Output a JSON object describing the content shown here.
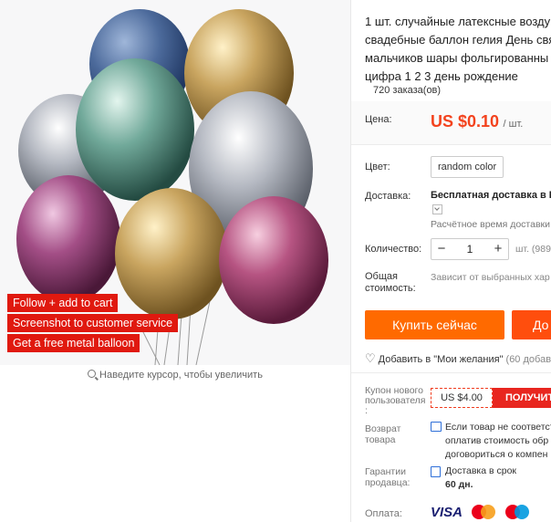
{
  "left": {
    "promos": [
      "Follow + add to cart",
      "Screenshot  to customer service",
      "Get a free metal balloon"
    ],
    "zoom_hint": "Наведите курсор, чтобы увеличить"
  },
  "product": {
    "title_lines": [
      "1 шт. случайные латексные возду",
      "свадебные баллон гелия День свя",
      "мальчиков шары фольгированны",
      "цифра 1 2 3 день рождение"
    ],
    "orders": "720 заказа(ов)"
  },
  "price": {
    "label": "Цена:",
    "amount": "US $0.10",
    "unit": "/ шт."
  },
  "color": {
    "label": "Цвет:",
    "value": "random color"
  },
  "shipping": {
    "label": "Доставка:",
    "title": "Бесплатная доставка в Ru",
    "estimate": "Расчётное время доставки"
  },
  "quantity": {
    "label": "Количество:",
    "minus": "−",
    "value": "1",
    "plus": "+",
    "note": "шт. (989"
  },
  "total": {
    "label_lines": [
      "Общая",
      "стоимость:"
    ],
    "note": "Зависит от выбранных хар"
  },
  "buttons": {
    "buy": "Купить сейчас",
    "cart": "До"
  },
  "wishlist": {
    "text": "Добавить в \"Мои желания\"",
    "count": "(60 добав"
  },
  "coupon": {
    "label_lines": [
      "Купон нового",
      "пользователя",
      ":"
    ],
    "value": "US $4.00",
    "button": "ПОЛУЧИТ"
  },
  "returns": {
    "label_lines": [
      "Возврат",
      "товара"
    ],
    "lines": [
      "Если товар не соответст",
      "оплатив стоимость обр",
      "договориться о компен"
    ]
  },
  "guarantee": {
    "label_lines": [
      "Гарантии",
      "продавца:"
    ],
    "line1": "Доставка в срок",
    "line2": "60 дн."
  },
  "payment": {
    "label": "Оплата:",
    "visa": "VISA"
  },
  "colors": {
    "accent": "#ff6a00",
    "price": "#f3431e",
    "promo": "#e0190f"
  }
}
